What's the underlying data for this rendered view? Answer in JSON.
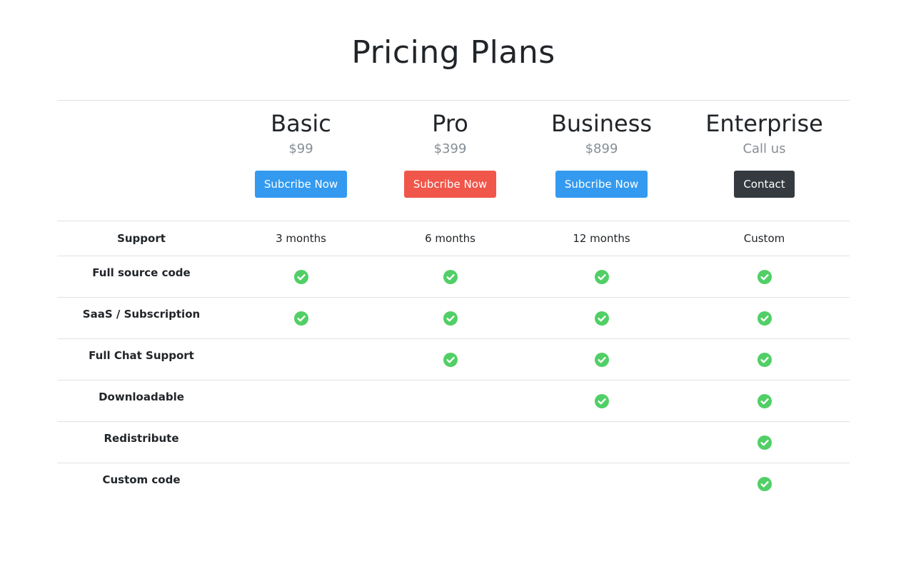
{
  "page": {
    "title": "Pricing Plans"
  },
  "plans": [
    {
      "name": "Basic",
      "price": "$99",
      "button": "Subcribe Now",
      "button_color": "#339af0"
    },
    {
      "name": "Pro",
      "price": "$399",
      "button": "Subcribe Now",
      "button_color": "#f0564a"
    },
    {
      "name": "Business",
      "price": "$899",
      "button": "Subcribe Now",
      "button_color": "#339af0"
    },
    {
      "name": "Enterprise",
      "price": "Call us",
      "button": "Contact",
      "button_color": "#343a40"
    }
  ],
  "support": {
    "label": "Support",
    "values": [
      "3 months",
      "6 months",
      "12 months",
      "Custom"
    ]
  },
  "features": [
    {
      "label": "Full source code",
      "included": [
        true,
        true,
        true,
        true
      ]
    },
    {
      "label": "SaaS / Subscription",
      "included": [
        true,
        true,
        true,
        true
      ]
    },
    {
      "label": "Full Chat Support",
      "included": [
        false,
        true,
        true,
        true
      ]
    },
    {
      "label": "Downloadable",
      "included": [
        false,
        false,
        true,
        true
      ]
    },
    {
      "label": "Redistribute",
      "included": [
        false,
        false,
        false,
        true
      ]
    },
    {
      "label": "Custom code",
      "included": [
        false,
        false,
        false,
        true
      ]
    }
  ],
  "icons": {
    "check": "check-circle-icon",
    "check_color": "#51cf66"
  }
}
